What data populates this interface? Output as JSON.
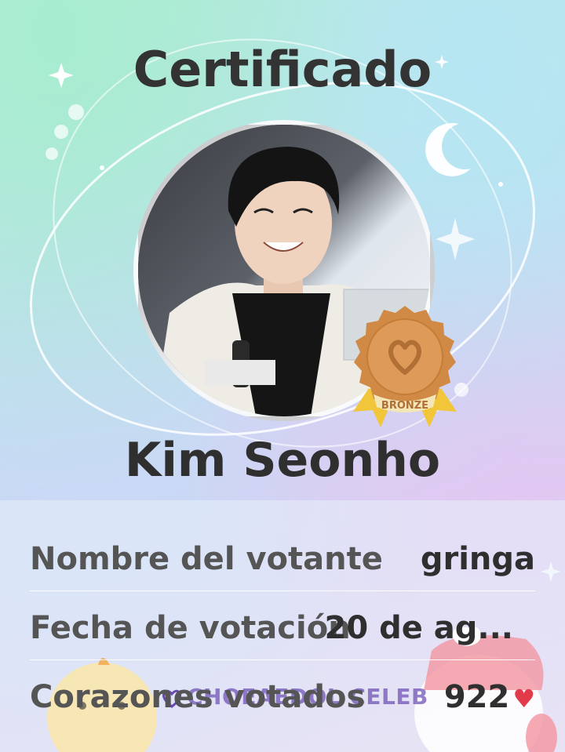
{
  "certificate": {
    "title": "Certificado",
    "celebrity_name": "Kim Seonho",
    "badge_label": "BRONZE",
    "rows": [
      {
        "label": "Nombre del votante",
        "value": "gringa"
      },
      {
        "label": "Fecha de votación",
        "value": "20 de ag..."
      },
      {
        "label": "Corazones votados",
        "value": "922"
      }
    ],
    "heart_symbol": "♥",
    "watermark": "CHOEAEDOL CELEB"
  },
  "colors": {
    "title": "#333333",
    "badge_bronze": "#d08a45",
    "heart": "#e23a4a",
    "watermark": "#684ab2"
  },
  "icons": [
    "moon-icon",
    "sparkle-icon",
    "medal-icon",
    "heart-icon",
    "chick-mascot",
    "bunny-mascot"
  ]
}
